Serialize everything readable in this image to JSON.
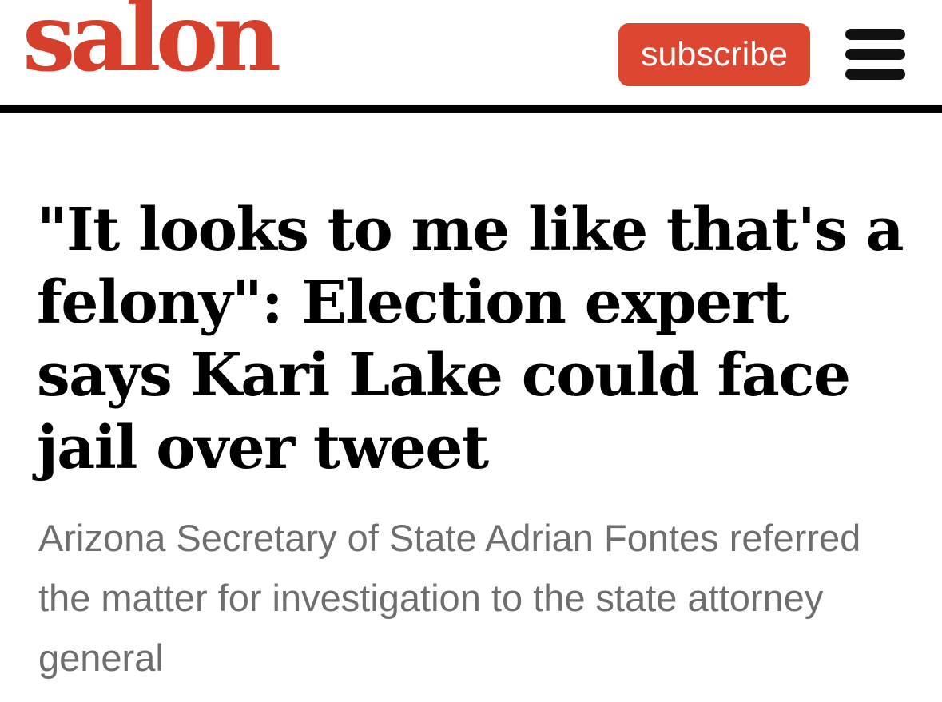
{
  "header": {
    "logo_text": "salon",
    "subscribe_label": "subscribe",
    "menu_icon": "hamburger-menu-icon"
  },
  "article": {
    "headline": "\"It looks to me like that's a felony\": Election expert says Kari Lake could face jail over tweet",
    "subheadline": "Arizona Secretary of State Adrian Fontes referred the matter for investigation to the state attorney general"
  },
  "colors": {
    "brand": "#d63f2b",
    "subscribe_bg": "#dd4631",
    "divider": "#000000",
    "headline": "#000000",
    "subheadline": "#6e6e6e"
  }
}
